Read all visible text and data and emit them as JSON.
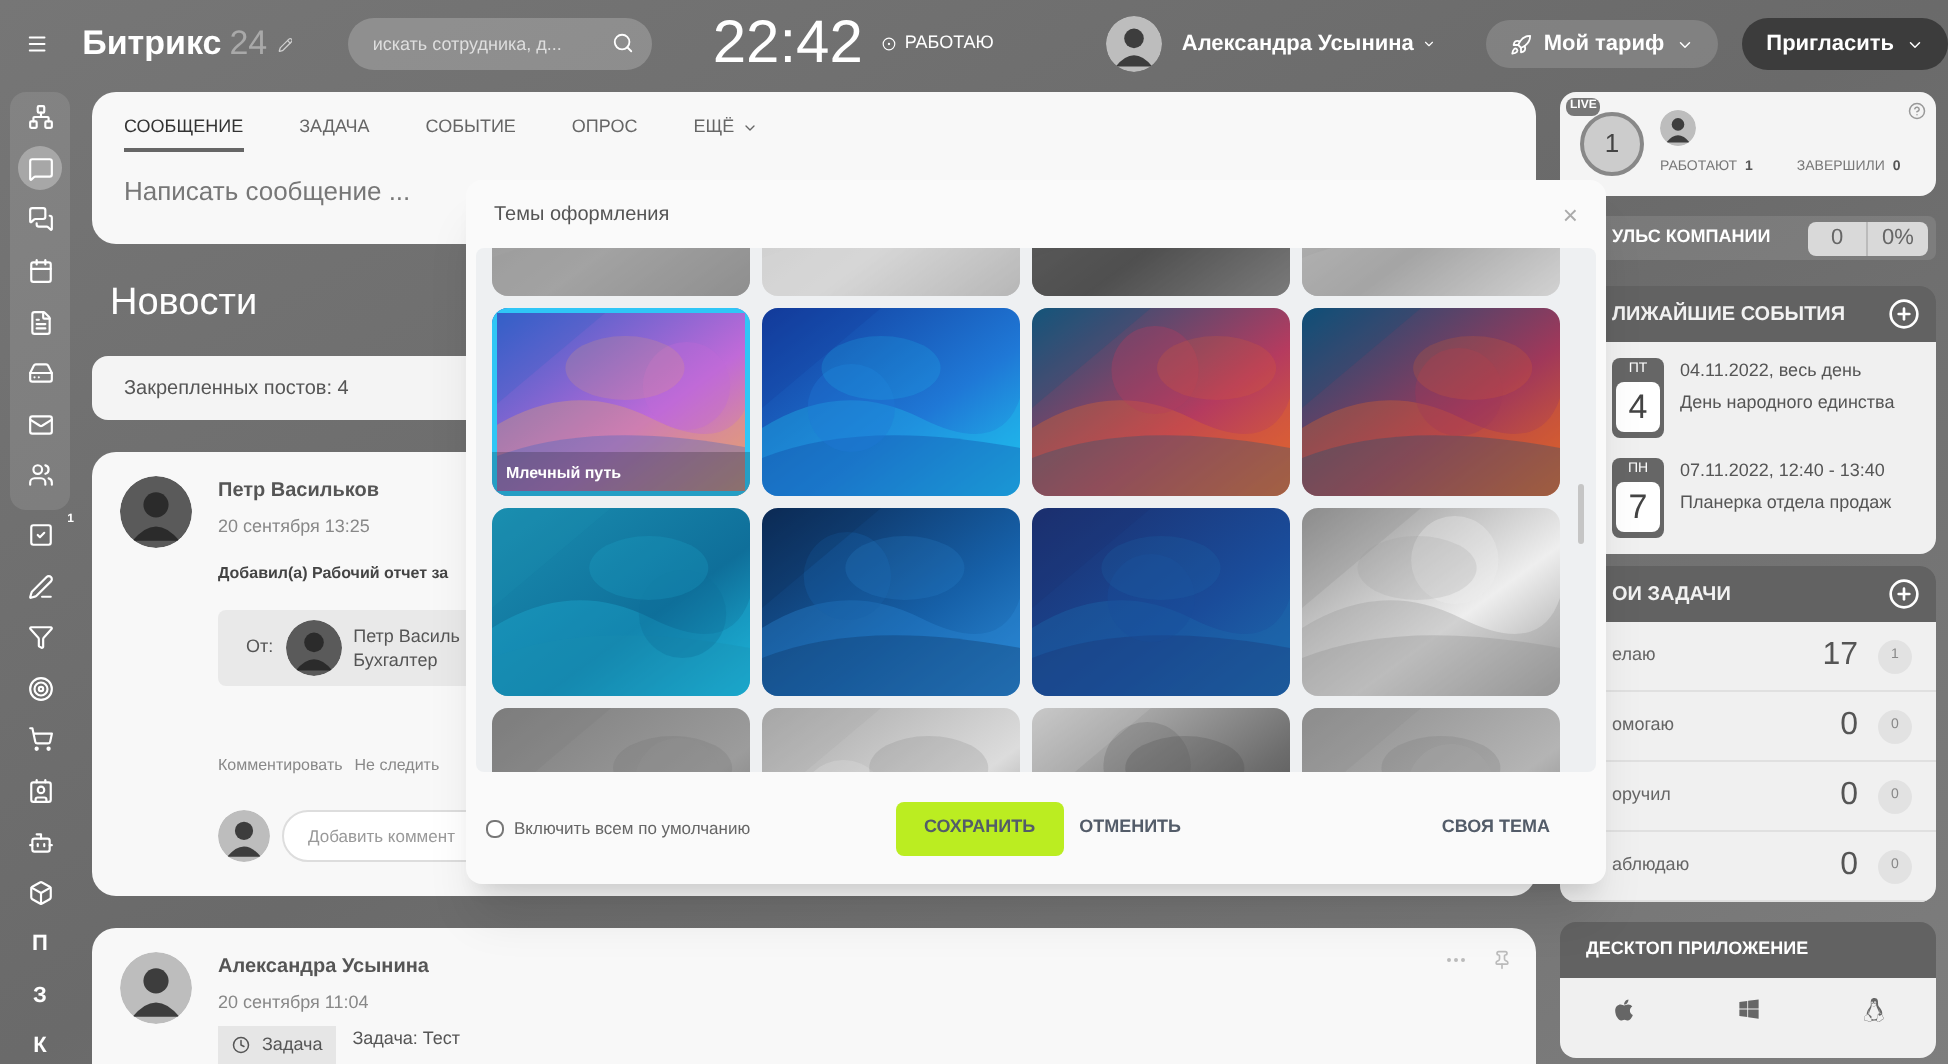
{
  "header": {
    "logo": "Битрикс",
    "logo_suffix": "24",
    "search": {
      "placeholder": "искать сотрудника, д..."
    },
    "time": "22:42",
    "status": "РАБОТАЮ",
    "user": "Александра Усынина",
    "tariff": "Мой тариф",
    "invite": "Пригласить"
  },
  "sidebar": {
    "items": [
      {
        "kind": "icon",
        "selected": false
      },
      {
        "kind": "icon",
        "selected": true
      },
      {
        "kind": "icon",
        "selected": false
      },
      {
        "kind": "icon",
        "selected": false
      },
      {
        "kind": "icon",
        "selected": false
      },
      {
        "kind": "icon",
        "selected": false
      },
      {
        "kind": "icon",
        "selected": false
      },
      {
        "kind": "icon",
        "selected": false
      },
      {
        "kind": "icon",
        "selected": false,
        "badge": "1"
      },
      {
        "kind": "icon",
        "selected": false
      },
      {
        "kind": "icon",
        "selected": false
      },
      {
        "kind": "icon",
        "selected": false
      },
      {
        "kind": "icon",
        "selected": false
      },
      {
        "kind": "icon",
        "selected": false
      },
      {
        "kind": "icon",
        "selected": false
      },
      {
        "kind": "icon",
        "selected": false
      },
      {
        "kind": "letter",
        "label": "П",
        "selected": false
      },
      {
        "kind": "letter",
        "label": "З",
        "selected": false
      },
      {
        "kind": "letter",
        "label": "К",
        "selected": false
      }
    ]
  },
  "composer": {
    "tabs": [
      {
        "label": "СООБЩЕНИЕ",
        "selected": true
      },
      {
        "label": "ЗАДАЧА",
        "selected": false
      },
      {
        "label": "СОБЫТИЕ",
        "selected": false
      },
      {
        "label": "ОПРОС",
        "selected": false
      },
      {
        "label": "ЕЩЁ",
        "selected": false,
        "dropdown": true
      }
    ],
    "placeholder": "Написать сообщение ..."
  },
  "feed_title": "Новости",
  "pinned": "Закрепленных постов: 4",
  "posts": [
    {
      "kind": "report",
      "author": "Петр Васильков",
      "date": "20 сентября 13:25",
      "text": "Добавил(а) Рабочий отчет за",
      "from_label": "От:",
      "from_name": "Петр Василь",
      "from_role": "Бухгалтер",
      "actions": [
        "Комментировать",
        "Не следить"
      ],
      "comment_placeholder": "Добавить коммент"
    },
    {
      "kind": "task",
      "author": "Александра Усынина",
      "date": "20 сентября 11:04",
      "tag": "Задача",
      "text": "Задача: Тест"
    }
  ],
  "live": {
    "badge": "LIVE",
    "count": "1",
    "working": "РАБОТАЮТ",
    "working_count": "1",
    "finished": "ЗАВЕРШИЛИ",
    "finished_count": "0"
  },
  "pulse": {
    "title": "УЛЬС КОМПАНИИ",
    "value": "0",
    "percent": "0%"
  },
  "events": {
    "title": "ЛИЖАЙШИЕ СОБЫТИЯ",
    "items": [
      {
        "day": "ПТ",
        "date": "4",
        "when": "04.11.2022, весь день",
        "title": "День народного единства"
      },
      {
        "day": "ПН",
        "date": "7",
        "when": "07.11.2022, 12:40 - 13:40",
        "title": "Планерка отдела продаж"
      }
    ]
  },
  "tasks": {
    "title": "ОИ ЗАДАЧИ",
    "rows": [
      {
        "label": "елаю",
        "count": "17",
        "badge": "1"
      },
      {
        "label": "омогаю",
        "count": "0",
        "badge": "0"
      },
      {
        "label": "оручил",
        "count": "0",
        "badge": "0"
      },
      {
        "label": "аблюдаю",
        "count": "0",
        "badge": "0"
      }
    ]
  },
  "desktop": {
    "title": "ДЕСКТОП ПРИЛОЖЕНИЕ"
  },
  "modal": {
    "title": "Темы оформления",
    "close": "×",
    "themes": [
      {
        "kind": "picture",
        "selected": false
      },
      {
        "kind": "picture",
        "selected": false
      },
      {
        "kind": "picture",
        "selected": false
      },
      {
        "kind": "picture",
        "selected": false
      },
      {
        "kind": "picture",
        "selected": true,
        "label": "Млечный путь"
      },
      {
        "kind": "picture",
        "selected": false
      },
      {
        "kind": "picture",
        "selected": false
      },
      {
        "kind": "picture",
        "selected": false
      },
      {
        "kind": "picture",
        "selected": false
      },
      {
        "kind": "picture",
        "selected": false
      },
      {
        "kind": "picture",
        "selected": false
      },
      {
        "kind": "picture",
        "selected": false
      },
      {
        "kind": "picture",
        "selected": false
      },
      {
        "kind": "picture",
        "selected": false
      },
      {
        "kind": "picture",
        "selected": false
      },
      {
        "kind": "picture",
        "selected": false
      }
    ],
    "default_all": {
      "label": "Включить всем по умолчанию",
      "checked": false
    },
    "save": "СОХРАНИТЬ",
    "cancel": "ОТМЕНИТЬ",
    "custom": "СВОЯ ТЕМА"
  }
}
